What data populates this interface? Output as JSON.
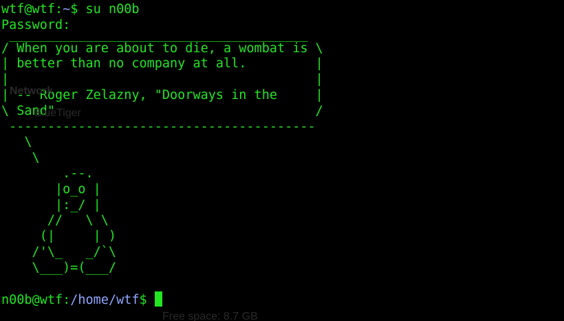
{
  "terminal": {
    "prompt_user": "wtf@wtf",
    "prompt_colon": ":",
    "prompt_path": "~",
    "prompt_symbol": "$ ",
    "command": "su n00b",
    "password_prompt": "Password:",
    "cowsay_lines": [
      " _______________________________________",
      "/ When you are about to die, a wombat is \\",
      "| better than no company at all.         |",
      "|                                        |",
      "| -- Roger Zelazny, \"Doorways in the     |",
      "\\ Sand\"                                  /",
      " ----------------------------------------",
      "   \\",
      "    \\",
      "        .--.",
      "       |o_o |",
      "       |:_/ |",
      "      //   \\ \\",
      "     (|     | )",
      "    /'\\_   _/`\\",
      "    \\___)=(___/"
    ],
    "prompt2_user": "n00b@wtf",
    "prompt2_colon": ":",
    "prompt2_path": "/home/wtf",
    "prompt2_symbol": "$ "
  },
  "background_ghost": {
    "network_label": "Network",
    "device_label": "BlueTiger",
    "free_space_label": "Free space: 8.7 GB"
  },
  "colors": {
    "text": "#22e622",
    "path": "#8fa6ff",
    "background": "#000000"
  }
}
